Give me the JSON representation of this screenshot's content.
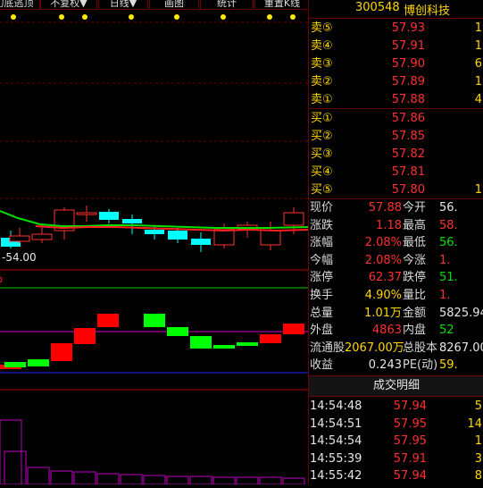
{
  "toolbar": {
    "buttons": [
      "幻底逃顶",
      "不复权▼",
      "日线▼",
      "画图",
      "统计",
      "重置K线"
    ]
  },
  "chart": {
    "price_label": "-54.00"
  },
  "stock": {
    "code": "300548",
    "name": "博创科技"
  },
  "orderbook": {
    "asks": [
      {
        "label": "卖⑤",
        "price": "57.93",
        "vol": "1"
      },
      {
        "label": "卖④",
        "price": "57.91",
        "vol": "1"
      },
      {
        "label": "卖③",
        "price": "57.90",
        "vol": "6"
      },
      {
        "label": "卖②",
        "price": "57.89",
        "vol": "1"
      },
      {
        "label": "卖①",
        "price": "57.88",
        "vol": "4"
      }
    ],
    "bids": [
      {
        "label": "买①",
        "price": "57.86",
        "vol": ""
      },
      {
        "label": "买②",
        "price": "57.85",
        "vol": ""
      },
      {
        "label": "买③",
        "price": "57.82",
        "vol": ""
      },
      {
        "label": "买④",
        "price": "57.81",
        "vol": ""
      },
      {
        "label": "买⑤",
        "price": "57.80",
        "vol": "1"
      }
    ]
  },
  "quote": {
    "rows": [
      {
        "l1": "现价",
        "v1": "57.88",
        "l2": "今开",
        "v2": "56."
      },
      {
        "l1": "涨跌",
        "v1": "1.18",
        "l2": "最高",
        "v2": "58."
      },
      {
        "l1": "涨幅",
        "v1": "2.08%",
        "l2": "最低",
        "v2": "56."
      },
      {
        "l1": "今幅",
        "v1": "2.08%",
        "l2": "今涨",
        "v2": "1."
      },
      {
        "l1": "涨停",
        "v1": "62.37",
        "l2": "跌停",
        "v2": "51."
      },
      {
        "l1": "换手",
        "v1": "4.90%",
        "l2": "量比",
        "v2": "1."
      },
      {
        "l1": "总量",
        "v1": "1.01万",
        "l2": "金额",
        "v2": "5825.94"
      },
      {
        "l1": "外盘",
        "v1": "4863",
        "l2": "内盘",
        "v2": "52"
      },
      {
        "l1": "流通股",
        "v1": "2067.00万",
        "l2": "总股本",
        "v2": "8267.00"
      },
      {
        "l1": "收益",
        "v1": "0.243",
        "l2": "PE(动)",
        "v2": "59."
      }
    ]
  },
  "ticks": {
    "title": "成交明细",
    "rows": [
      {
        "time": "14:54:48",
        "price": "57.94",
        "vol": "5"
      },
      {
        "time": "14:54:51",
        "price": "57.95",
        "vol": "14"
      },
      {
        "time": "14:54:54",
        "price": "57.95",
        "vol": "1"
      },
      {
        "time": "14:55:39",
        "price": "57.91",
        "vol": "3"
      },
      {
        "time": "14:55:42",
        "price": "57.94",
        "vol": "8"
      }
    ]
  },
  "colors": {
    "up": "#ff3030",
    "down": "#00ffff",
    "ma_green": "#00e000",
    "ma_red": "#ff2020",
    "bar_red": "#ff0000",
    "bar_green": "#00ff00",
    "grid": "#6a0000",
    "volume": "#c000c0"
  }
}
